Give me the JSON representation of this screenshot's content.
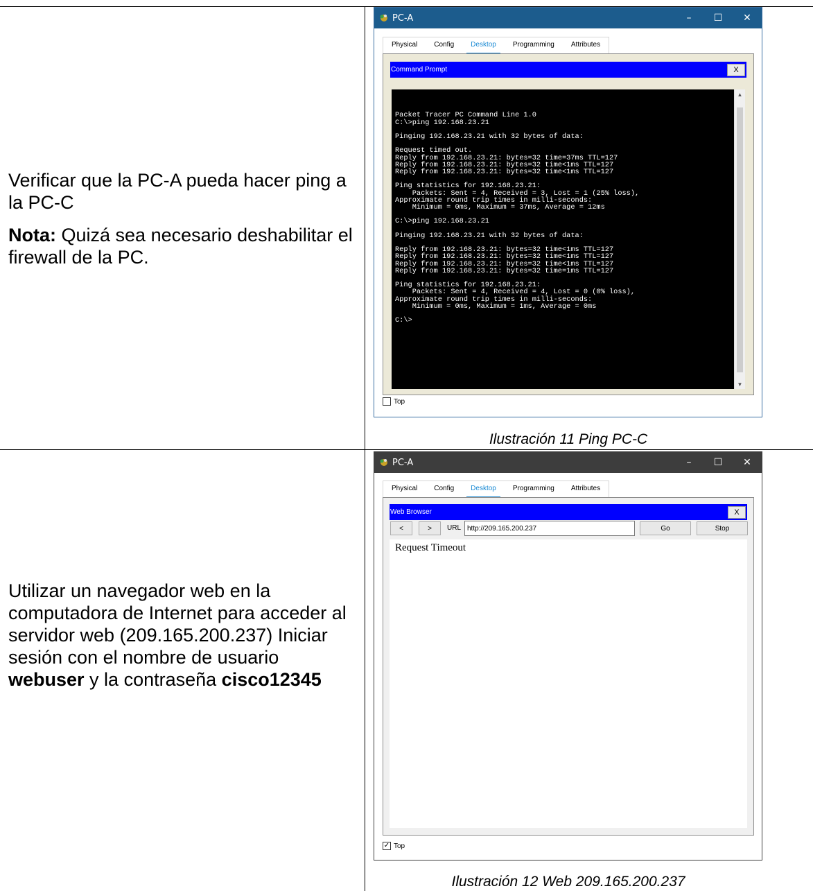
{
  "row1": {
    "instruction": "Verificar que la PC-A pueda hacer ping a la PC-C",
    "note_label": "Nota:",
    "note_text": " Quizá sea necesario deshabilitar el firewall de la PC.",
    "caption": "Ilustración 11 Ping PC-C"
  },
  "row2": {
    "text_1": "Utilizar un navegador web en la computadora de Internet para acceder al servidor web (209.165.200.237) Iniciar sesión con el nombre de usuario ",
    "username": "webuser",
    "text_2": " y la contraseña ",
    "password": "cisco12345",
    "caption": "Ilustración 12 Web 209.165.200.237"
  },
  "window1": {
    "title": "PC-A",
    "tabs": [
      "Physical",
      "Config",
      "Desktop",
      "Programming",
      "Attributes"
    ],
    "active_tab": "Desktop",
    "app_title": "Command Prompt",
    "close_label": "X",
    "terminal_lines": [
      "Packet Tracer PC Command Line 1.0",
      "C:\\>ping 192.168.23.21",
      "",
      "Pinging 192.168.23.21 with 32 bytes of data:",
      "",
      "Request timed out.",
      "Reply from 192.168.23.21: bytes=32 time=37ms TTL=127",
      "Reply from 192.168.23.21: bytes=32 time<1ms TTL=127",
      "Reply from 192.168.23.21: bytes=32 time<1ms TTL=127",
      "",
      "Ping statistics for 192.168.23.21:",
      "    Packets: Sent = 4, Received = 3, Lost = 1 (25% loss),",
      "Approximate round trip times in milli-seconds:",
      "    Minimum = 0ms, Maximum = 37ms, Average = 12ms",
      "",
      "C:\\>ping 192.168.23.21",
      "",
      "Pinging 192.168.23.21 with 32 bytes of data:",
      "",
      "Reply from 192.168.23.21: bytes=32 time<1ms TTL=127",
      "Reply from 192.168.23.21: bytes=32 time<1ms TTL=127",
      "Reply from 192.168.23.21: bytes=32 time<1ms TTL=127",
      "Reply from 192.168.23.21: bytes=32 time=1ms TTL=127",
      "",
      "Ping statistics for 192.168.23.21:",
      "    Packets: Sent = 4, Received = 4, Lost = 0 (0% loss),",
      "Approximate round trip times in milli-seconds:",
      "    Minimum = 0ms, Maximum = 1ms, Average = 0ms",
      "",
      "C:\\>"
    ],
    "top_label": "Top",
    "top_checked": false
  },
  "window2": {
    "title": "PC-A",
    "tabs": [
      "Physical",
      "Config",
      "Desktop",
      "Programming",
      "Attributes"
    ],
    "active_tab": "Desktop",
    "app_title": "Web Browser",
    "close_label": "X",
    "back_label": "<",
    "forward_label": ">",
    "url_label": "URL",
    "url_value": "http://209.165.200.237",
    "go_label": "Go",
    "stop_label": "Stop",
    "page_text": "Request Timeout",
    "top_label": "Top",
    "top_checked": true
  },
  "colors": {
    "titlebar_active": "#1c5c8d",
    "titlebar_inactive": "#3d3d3d",
    "app_bar": "#0000ff",
    "tab_active": "#1a8ad4"
  }
}
